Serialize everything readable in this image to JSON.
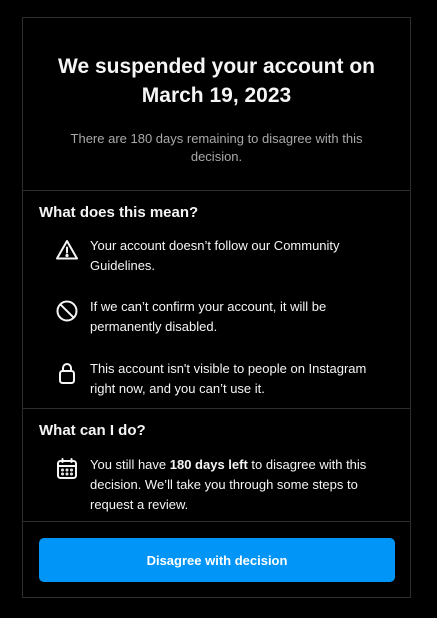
{
  "header": {
    "title": "We suspended your account on March 19, 2023",
    "subtitle": "There are 180 days remaining to disagree with this decision."
  },
  "meaning": {
    "title": "What does this mean?",
    "items": [
      {
        "icon": "warning-triangle-icon",
        "text": "Your account doesn’t follow our Community Guidelines."
      },
      {
        "icon": "blocked-circle-icon",
        "text": "If we can’t confirm your account, it will be permanently disabled."
      },
      {
        "icon": "lock-icon",
        "text": "This account isn't visible to people on Instagram right now, and you can’t use it."
      }
    ]
  },
  "action": {
    "title": "What can I do?",
    "icon": "calendar-icon",
    "text_before": "You still have ",
    "text_bold": "180 days left",
    "text_after": " to disagree with this decision. We’ll take you through some steps to request a review."
  },
  "button": {
    "label": "Disagree with decision"
  },
  "colors": {
    "background": "#000000",
    "border": "#2e2e2e",
    "primary": "#0095f6",
    "muted_text": "#a8a8a8"
  }
}
